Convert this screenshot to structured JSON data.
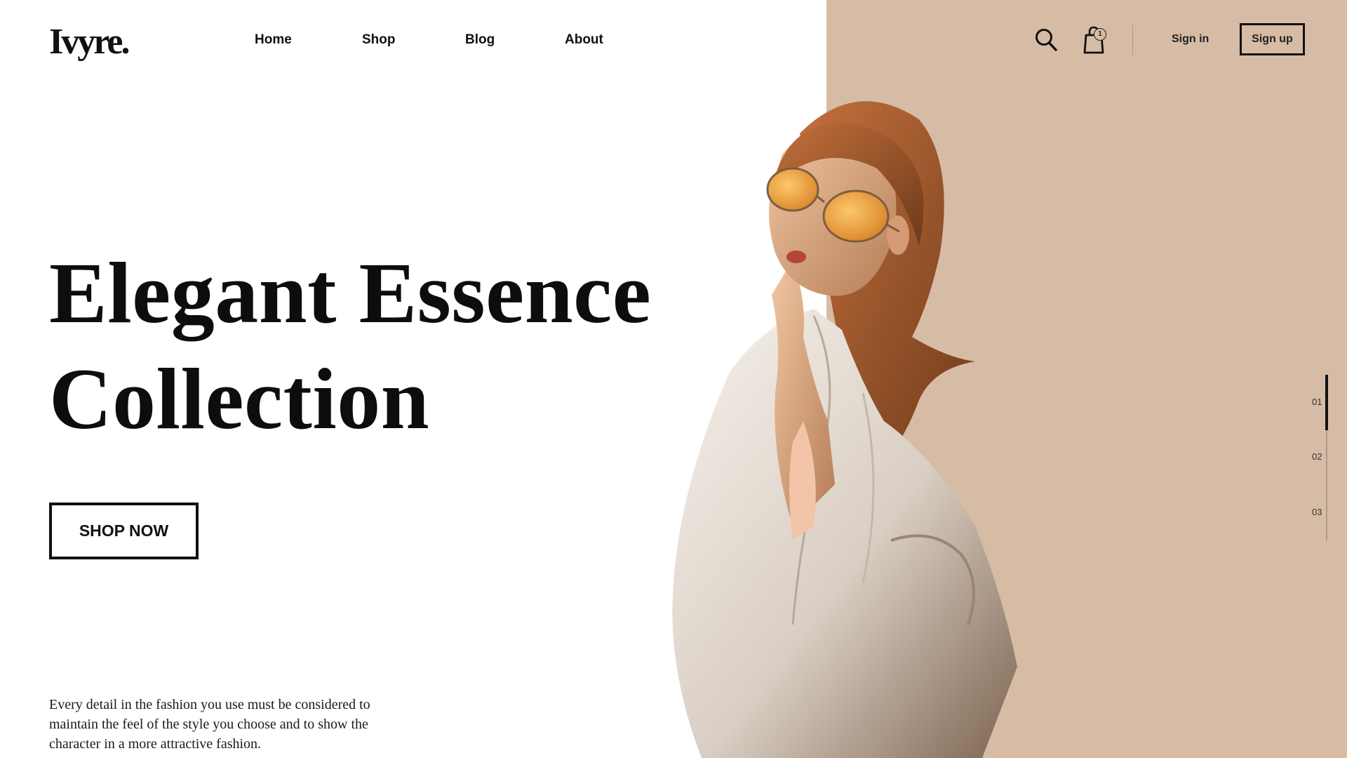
{
  "colors": {
    "accent_panel": "#d6bca5",
    "text": "#111111",
    "background": "#ffffff"
  },
  "header": {
    "logo": "Ivyre.",
    "nav": [
      "Home",
      "Shop",
      "Blog",
      "About"
    ],
    "cart_count": "1",
    "sign_in": "Sign in",
    "sign_up": "Sign up",
    "icons": [
      "search-icon",
      "shopping-bag-icon"
    ]
  },
  "hero": {
    "title_line1": "Elegant Essence",
    "title_line2": "Collection",
    "cta": "SHOP NOW",
    "description": "Every detail in the fashion you use must be considered to maintain the feel of the style you choose and to show the character in a more attractive fashion."
  },
  "slider": {
    "items": [
      "01",
      "02",
      "03"
    ],
    "active": 1
  }
}
